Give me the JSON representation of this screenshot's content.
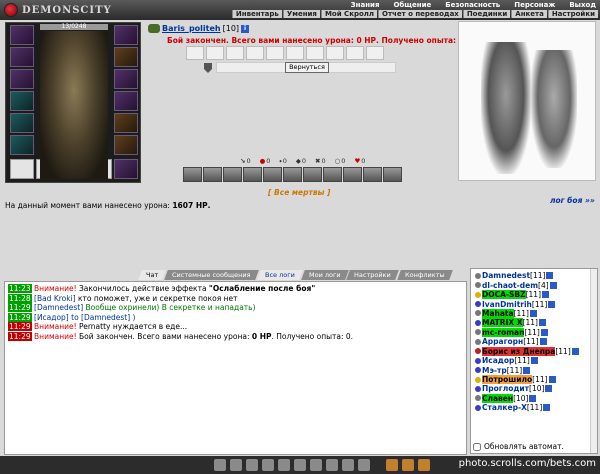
{
  "header": {
    "logo_text": "DEMONSCITY",
    "nav_primary": [
      "Знания",
      "Общение",
      "Безопасность",
      "Персонаж",
      "Выход"
    ],
    "nav_secondary": [
      "Инвентарь",
      "Умения",
      "Мой Скролл",
      "Отчет о переводах",
      "Поединки",
      "Анкета",
      "Настройки"
    ]
  },
  "equipment": {
    "hp_text": "13/0248"
  },
  "battle": {
    "player_name": "Baris_politeh",
    "player_level": "[10]",
    "result_text": "Бой закончен. Всего вами нанесено урона: 0 НР. Получено опыта: 0.",
    "return_button": "Вернуться",
    "stats": [
      "0",
      "0",
      "0",
      "0",
      "0",
      "0",
      "0"
    ],
    "all_dead": "[ Все мертвы ]",
    "log_link": "лог боя »»",
    "damage_prefix": "На данный момент вами нанесено урона:",
    "damage_value": "1607 НР."
  },
  "tabs": [
    "Чат",
    "Системные сообщения",
    "Все логи",
    "Мои логи",
    "Настройки",
    "Конфликты"
  ],
  "chat": [
    {
      "time": "11:23",
      "red": false,
      "warn": "Внимание!",
      "text": "Закончилось действие эффекта ",
      "bold": "\"Ослабление после боя\""
    },
    {
      "time": "11:28",
      "red": false,
      "nick": "[Bad Kroki]",
      "text": " кто поможет, уже и секретке покоя нет"
    },
    {
      "time": "11:29",
      "red": false,
      "nick": "[Damnedest]",
      "green": " Вообще охринели) В секретке и нападать)"
    },
    {
      "time": "11:29",
      "red": false,
      "nick": "[Исадор]",
      "to": " to [Damnedest] )"
    },
    {
      "time": "11:29",
      "red": true,
      "warn": "Внимание!",
      "text": " Pernatty нуждается в еде..."
    },
    {
      "time": "11:29",
      "red": true,
      "warn": "Внимание!",
      "text": " Бой закончен. Всего вами нанесено урона: ",
      "bold": "0 НР",
      "tail": ". Получено опыта: 0."
    }
  ],
  "online": [
    {
      "name": "Damnedest",
      "lvl": "[11]",
      "icon": "g",
      "hl": ""
    },
    {
      "name": "dl-chaot-dem",
      "lvl": "[4]",
      "icon": "g",
      "hl": ""
    },
    {
      "name": "DOCA-SBZ",
      "lvl": "[11]",
      "icon": "y",
      "hl": "hl-green"
    },
    {
      "name": "IvanDmitrih",
      "lvl": "[11]",
      "icon": "b",
      "hl": ""
    },
    {
      "name": "Mahata",
      "lvl": "[11]",
      "icon": "g",
      "hl": "hl-green"
    },
    {
      "name": "MATRIX X",
      "lvl": "[11]",
      "icon": "b",
      "hl": "hl-green"
    },
    {
      "name": "mc-roman",
      "lvl": "[11]",
      "icon": "g",
      "hl": "hl-green"
    },
    {
      "name": "Аррагорн",
      "lvl": "[11]",
      "icon": "g",
      "hl": ""
    },
    {
      "name": "Борис из Днепра",
      "lvl": "[11]",
      "icon": "r",
      "hl": "hl-red"
    },
    {
      "name": "Исадор",
      "lvl": "[11]",
      "icon": "b",
      "hl": ""
    },
    {
      "name": "Мэ-тр",
      "lvl": "[11]",
      "icon": "b",
      "hl": ""
    },
    {
      "name": "Потрошило",
      "lvl": "[11]",
      "icon": "y",
      "hl": "hl-orange"
    },
    {
      "name": "Проглодит",
      "lvl": "[10]",
      "icon": "b",
      "hl": ""
    },
    {
      "name": "Славен",
      "lvl": "[10]",
      "icon": "g",
      "hl": "hl-green"
    },
    {
      "name": "Сталкер-X",
      "lvl": "[11]",
      "icon": "b",
      "hl": ""
    }
  ],
  "auto_update_label": "Обновлять автомат.",
  "footer": {
    "watermark": "photo.scrolls.com/bets.com"
  }
}
